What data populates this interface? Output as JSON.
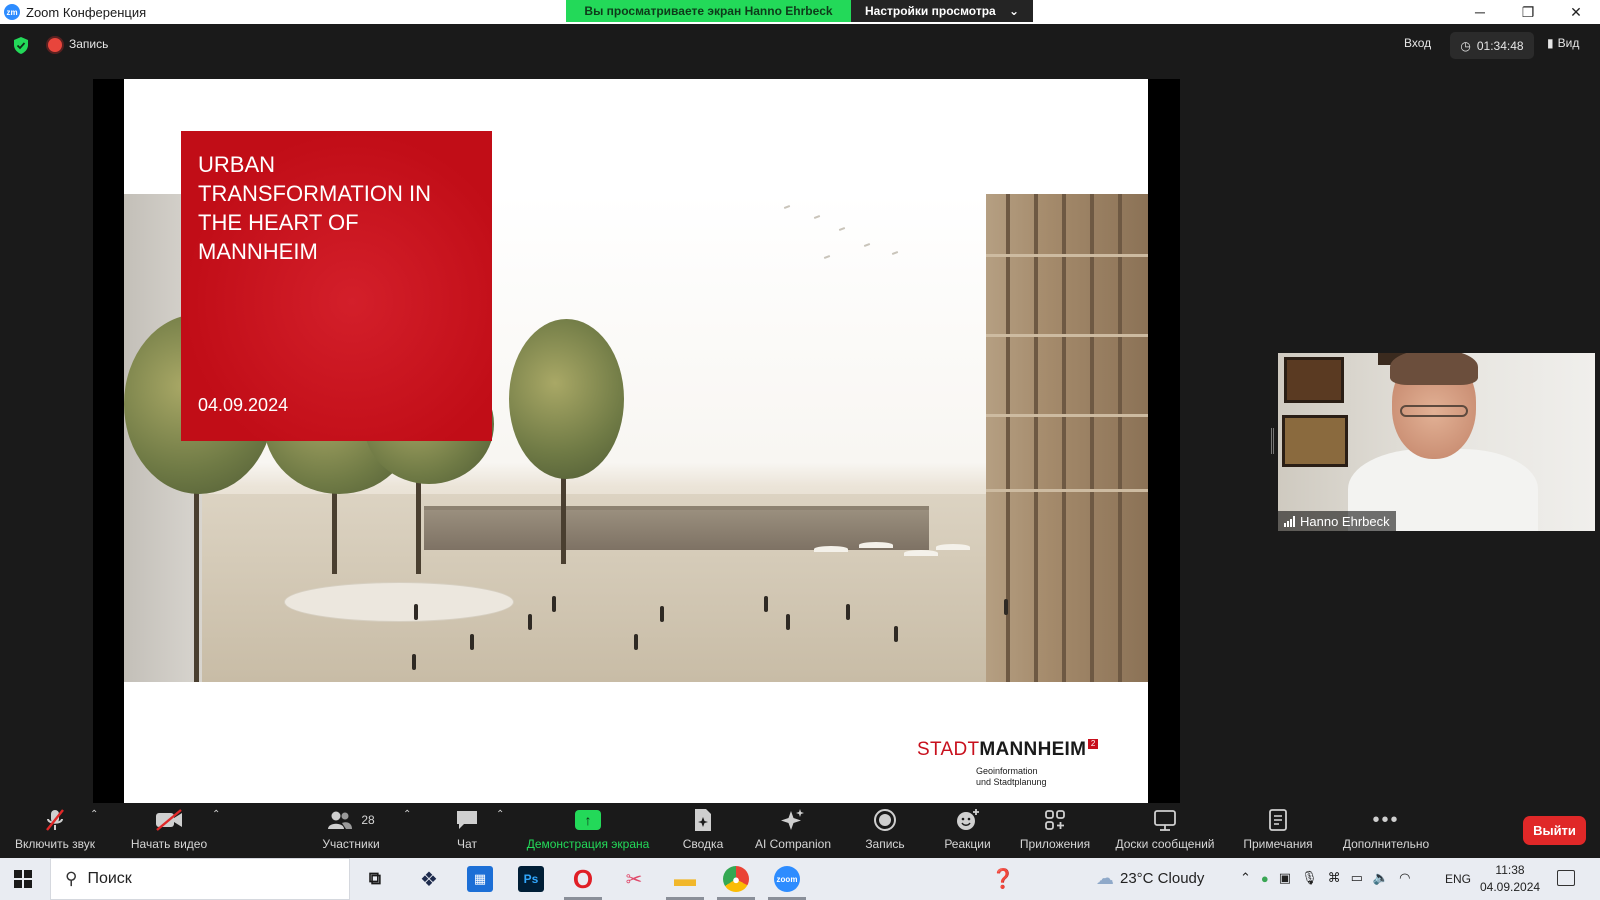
{
  "window": {
    "title": "Zoom Конференция",
    "share_banner": "Вы просматриваете экран Hanno Ehrbeck",
    "view_settings": "Настройки просмотра",
    "controls": [
      "─",
      "❐",
      "✕"
    ]
  },
  "meeting_bar": {
    "recording_label": "Запись",
    "enter_label": "Вход",
    "timer": "01:34:48",
    "view_label": "Вид"
  },
  "slide": {
    "title": "URBAN TRANSFORMATION IN THE HEART OF MANNHEIM",
    "date": "04.09.2024",
    "logo_stadt": "STADT",
    "logo_mannheim": "MANNHEIM",
    "logo_superscript": "2",
    "logo_sub_line1": "Geoinformation",
    "logo_sub_line2": "und Stadtplanung"
  },
  "speaker": {
    "name": "Hanno Ehrbeck"
  },
  "toolbar": {
    "audio": "Включить звук",
    "video": "Начать видео",
    "participants": "Участники",
    "participants_count": "28",
    "chat": "Чат",
    "share": "Демонстрация экрана",
    "summary": "Сводка",
    "ai": "AI Companion",
    "record": "Запись",
    "reactions": "Реакции",
    "apps": "Приложения",
    "whiteboards": "Доски сообщений",
    "notes": "Примечания",
    "more": "Дополнительно",
    "leave": "Выйти"
  },
  "taskbar": {
    "search_placeholder": "Поиск",
    "weather": "23°C  Cloudy",
    "language": "ENG",
    "time": "11:38",
    "date": "04.09.2024"
  },
  "colors": {
    "accent_green": "#23d959",
    "slide_red": "#c10d17",
    "leave_red": "#e02828"
  }
}
